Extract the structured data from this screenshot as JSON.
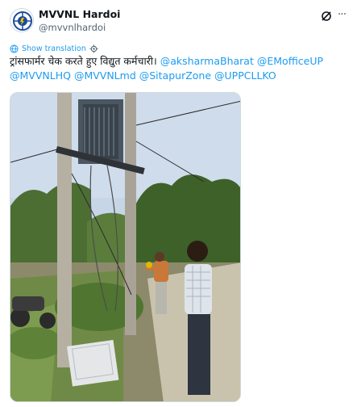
{
  "post": {
    "author": {
      "display_name": "MVVNL Hardoi",
      "handle": "@mvvnlhardoi"
    },
    "show_translation": "Show translation",
    "text": "ट्रांसफार्मर चेक करते हुए विद्युत कर्मचारी।",
    "mentions": [
      "@aksharmaBharat",
      "@EMofficeUP",
      "@MVVNLHQ",
      "@MVVNLmd",
      "@SitapurZone",
      "@UPPCLLKO"
    ]
  },
  "icons": {
    "more": "more-dots-icon",
    "grok": "grok-icon",
    "translate": "globe-icon",
    "settings": "gear-icon"
  },
  "colors": {
    "accent": "#1d9bf0",
    "secondary": "#536471"
  }
}
